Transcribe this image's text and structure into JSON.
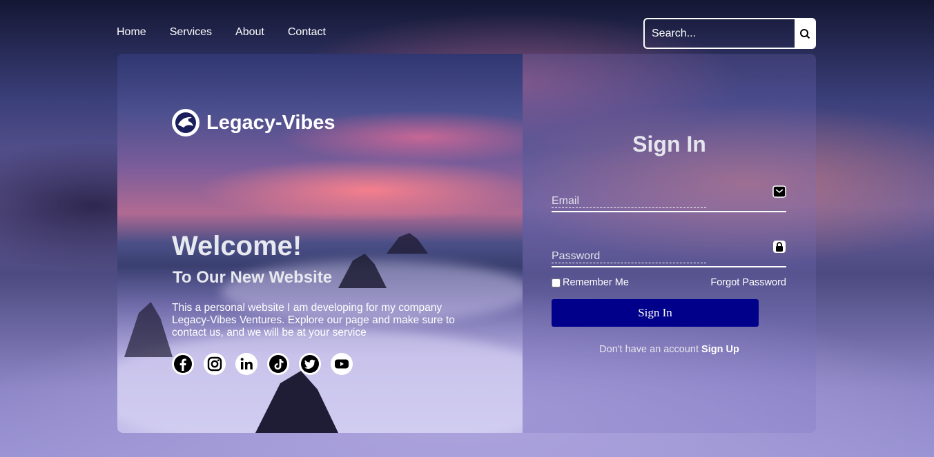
{
  "nav": {
    "items": [
      "Home",
      "Services",
      "About",
      "Contact"
    ]
  },
  "search": {
    "placeholder": "Search...",
    "icon": "search-icon"
  },
  "brand": {
    "name": "Legacy-Vibes",
    "logo_icon": "eagle-logo-icon"
  },
  "hero": {
    "title": "Welcome!",
    "subtitle": "To Our New Website",
    "description": "This a personal website I am developing for my company Legacy-Vibes Ventures. Explore our page and make sure to contact us, and we will be at your service"
  },
  "socials": [
    "facebook-icon",
    "instagram-icon",
    "linkedin-icon",
    "tiktok-icon",
    "twitter-icon",
    "youtube-icon"
  ],
  "form": {
    "title": "Sign In",
    "email_placeholder": "Email",
    "email_icon": "envelope-icon",
    "password_placeholder": "Password",
    "password_icon": "lock-icon",
    "remember_label": "Remember Me",
    "forgot_label": "Forgot Password",
    "submit_label": "Sign In",
    "signup_text": "Don't have an account",
    "signup_link": "Sign Up"
  },
  "colors": {
    "submit_bg": "#00008b",
    "text": "#ffffff"
  }
}
